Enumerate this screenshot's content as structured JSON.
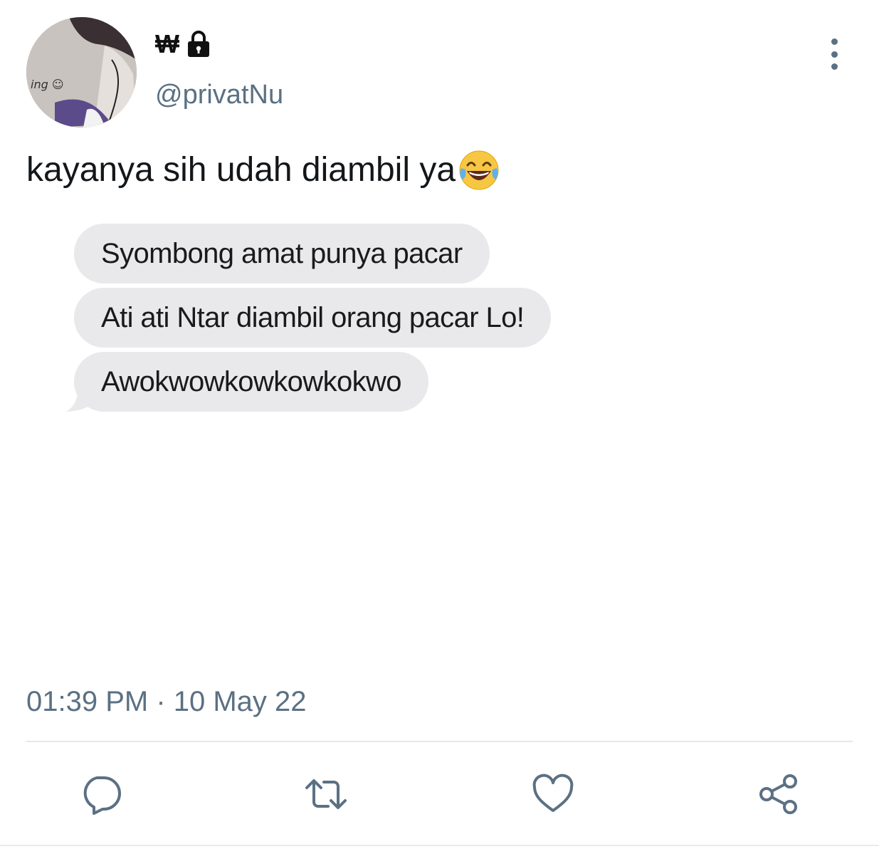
{
  "tweet": {
    "author": {
      "display_name": "₩",
      "handle": "@privatNu",
      "protected_icon": "lock-icon",
      "avatar_text": "ing ☺"
    },
    "text": "kayanya sih udah diambil ya",
    "text_emoji": "face-with-tears-of-joy",
    "attached_image": {
      "messages": [
        "Syombong amat punya pacar",
        "Ati ati Ntar diambil orang pacar Lo!",
        "Awokwowkowkowkokwo"
      ]
    },
    "timestamp": "01:39 PM · 10 May 22",
    "actions": [
      {
        "icon": "reply-icon"
      },
      {
        "icon": "retweet-icon"
      },
      {
        "icon": "like-icon"
      },
      {
        "icon": "share-icon"
      }
    ],
    "more_icon": "more-options-icon"
  },
  "colors": {
    "secondary_text": "#5b7083",
    "primary_text": "#14171a",
    "bubble_bg": "#e9e9eb",
    "divider": "#e1e8ed"
  }
}
